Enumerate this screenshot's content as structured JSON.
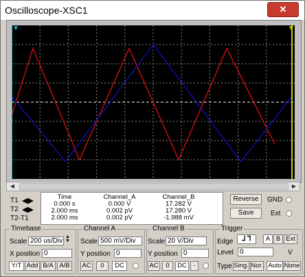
{
  "window": {
    "title": "Oscilloscope-XSC1",
    "close_glyph": "✕"
  },
  "colors": {
    "screen_bg": "#000000",
    "grid": "#909090",
    "channel_a": "#d01010",
    "channel_b": "#1010b0",
    "cursor1": "#20b0c0",
    "cursor2": "#c8c800"
  },
  "chart_data": {
    "type": "line",
    "title": "",
    "xlabel": "",
    "ylabel": "",
    "grid": true,
    "timebase_per_div": "200 us/Div",
    "series": [
      {
        "name": "Channel_A",
        "color": "#d01010",
        "waveform": "triangle",
        "points": [
          [
            0.0,
            -0.7
          ],
          [
            0.75,
            2.8
          ],
          [
            2.4,
            -3.0
          ],
          [
            4.15,
            2.8
          ],
          [
            5.9,
            -3.0
          ],
          [
            7.6,
            2.8
          ],
          [
            9.3,
            -2.2
          ]
        ]
      },
      {
        "name": "Channel_B",
        "color": "#1010b0",
        "waveform": "triangle",
        "points": [
          [
            0.0,
            0.3
          ],
          [
            1.9,
            -3.1
          ],
          [
            5.0,
            3.0
          ],
          [
            8.1,
            -3.1
          ],
          [
            9.9,
            0.3
          ]
        ]
      }
    ]
  },
  "cursors": {
    "t1_icon": "cursor-t1-icon",
    "t2_icon": "cursor-t2-icon"
  },
  "readout": {
    "row_labels": [
      "T1",
      "T2",
      "T2-T1"
    ],
    "headers": {
      "time": "Time",
      "a": "Channel_A",
      "b": "Channel_B"
    },
    "rows": [
      {
        "time": "0.000 s",
        "a": "0.000 V",
        "b": "17.282 V"
      },
      {
        "time": "2.000 ms",
        "a": "0.002 pV",
        "b": "17.280 V"
      },
      {
        "time": "2.000 ms",
        "a": "0.002 pV",
        "b": "-1.988 mV"
      }
    ]
  },
  "buttons": {
    "reverse": "Reverse",
    "save": "Save",
    "gnd": "GND",
    "ext": "Ext"
  },
  "timebase": {
    "title": "Timebase",
    "scale_label": "Scale",
    "scale_value": "200 us/Div",
    "xpos_label": "X position",
    "xpos_value": "0",
    "modes": [
      "Y/T",
      "Add",
      "B/A",
      "A/B"
    ]
  },
  "channel_a": {
    "title": "Channel A",
    "scale_label": "Scale",
    "scale_value": "500 mV/Div",
    "ypos_label": "Y position",
    "ypos_value": "0",
    "coupling": [
      "AC",
      "0",
      "DC"
    ]
  },
  "channel_b": {
    "title": "Channel B",
    "scale_label": "Scale",
    "scale_value": "20  V/Div",
    "ypos_label": "Y position",
    "ypos_value": "0",
    "coupling": [
      "AC",
      "0",
      "DC",
      "-"
    ]
  },
  "trigger": {
    "title": "Trigger",
    "edge_label": "Edge",
    "edge_sources": [
      "A",
      "B",
      "Ext"
    ],
    "level_label": "Level",
    "level_value": "0",
    "level_unit": "V",
    "type_label": "Type",
    "types": [
      "Sing.",
      "Nor.",
      "Auto",
      "None"
    ]
  }
}
